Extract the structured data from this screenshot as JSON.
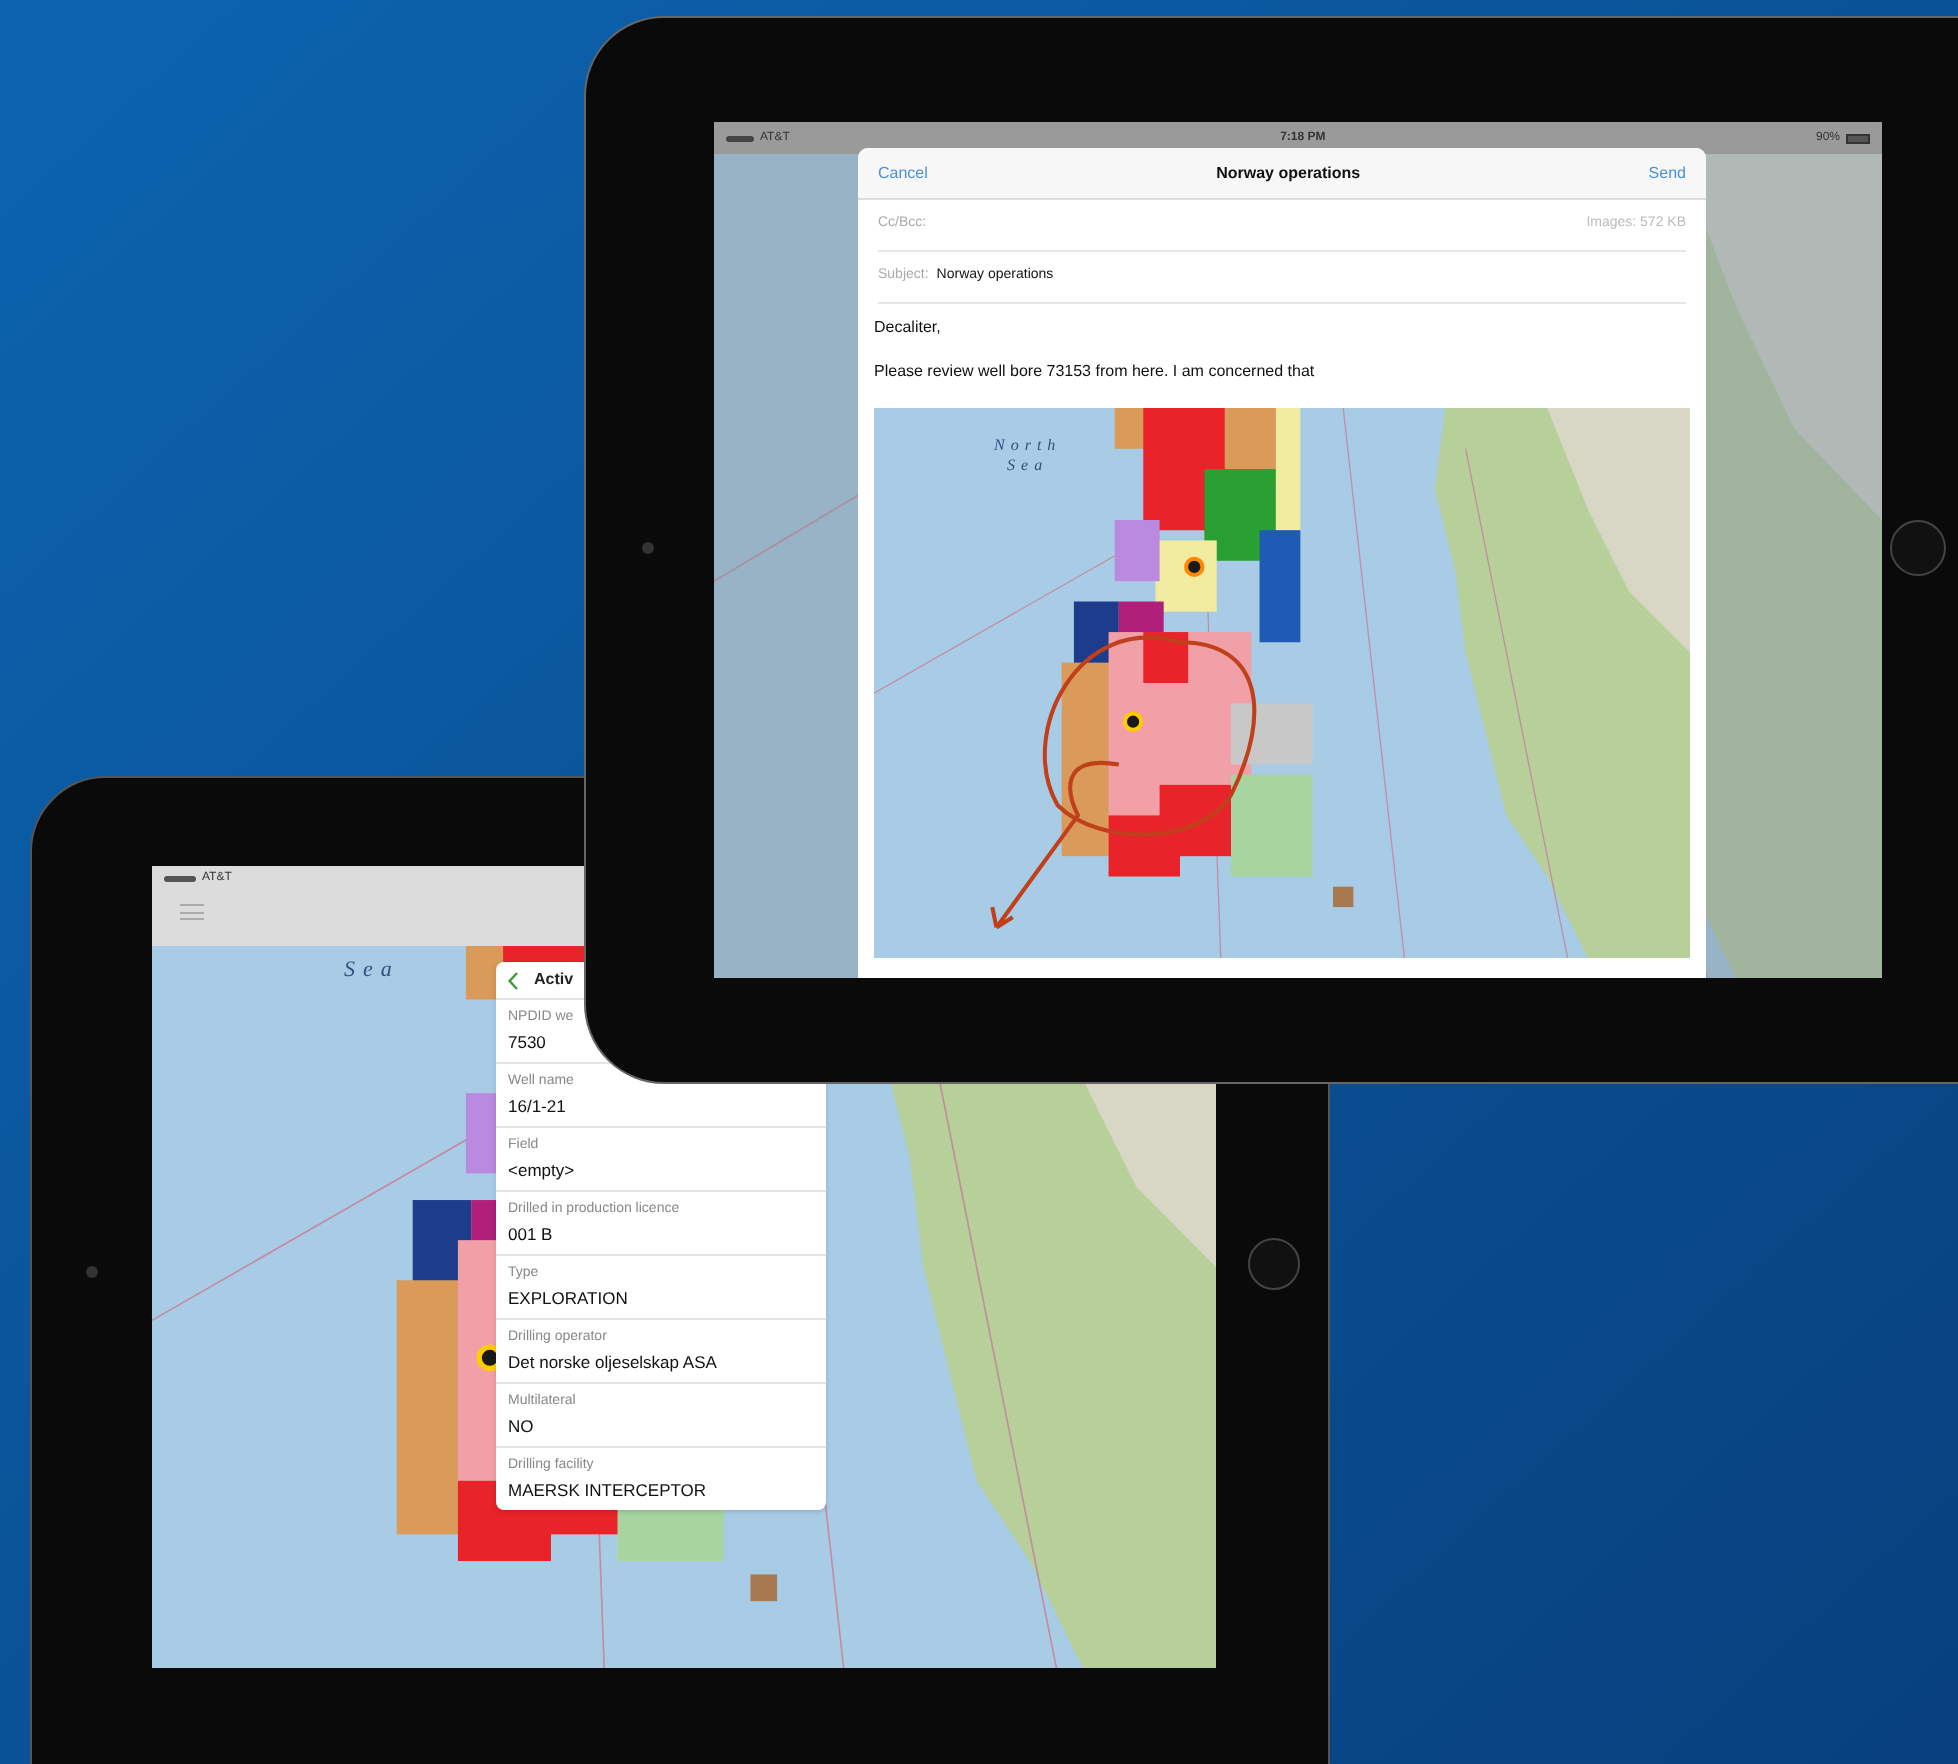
{
  "front_tablet": {
    "status_bar": {
      "carrier": "AT&T",
      "time": "7:18 PM",
      "battery": "90%"
    },
    "compose": {
      "cancel": "Cancel",
      "title": "Norway operations",
      "send": "Send",
      "cc_label": "Cc/Bcc:",
      "attachment_info": "Images: 572 KB",
      "subject_label": "Subject:",
      "subject": "Norway operations",
      "body": [
        "Decaliter,",
        "Please review well bore 73153 from here. I am concerned that"
      ],
      "map_labels": [
        "North",
        "Sea"
      ]
    }
  },
  "back_tablet": {
    "status_bar": {
      "carrier": "AT&T"
    },
    "map_label": "Sea",
    "panel": {
      "title": "Activ",
      "fields": [
        {
          "label": "NPDID we",
          "value": "7530"
        },
        {
          "label": "Well name",
          "value": "16/1-21"
        },
        {
          "label": "Field",
          "value": "<empty>"
        },
        {
          "label": "Drilled in production licence",
          "value": "001 B"
        },
        {
          "label": "Type",
          "value": "EXPLORATION"
        },
        {
          "label": "Drilling operator",
          "value": "Det norske oljeselskap ASA"
        },
        {
          "label": "Multilateral",
          "value": "NO"
        },
        {
          "label": "Drilling facility",
          "value": "MAERSK INTERCEPTOR"
        }
      ]
    }
  }
}
